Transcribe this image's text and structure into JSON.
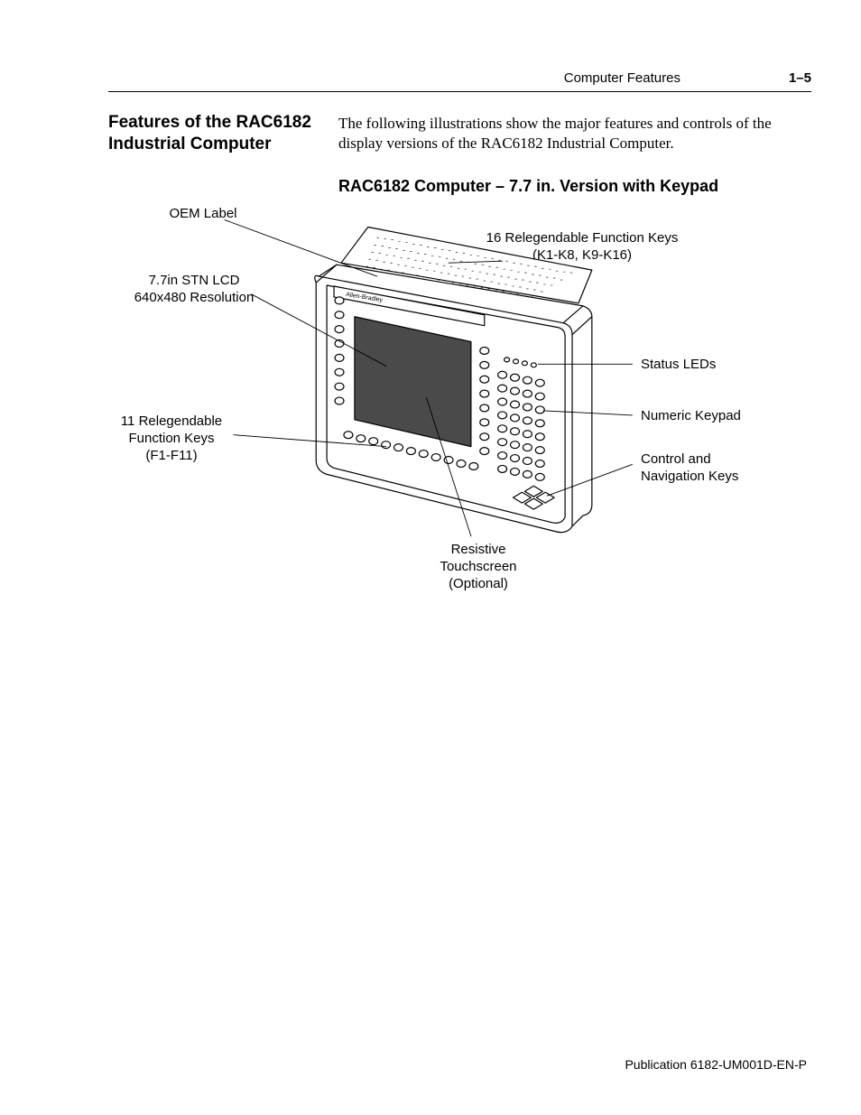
{
  "header": {
    "section": "Computer Features",
    "page": "1–5"
  },
  "section_heading": "Features of the RAC6182 Industrial Computer",
  "intro": "The following illustrations show the major features and controls of the display versions of the RAC6182 Industrial Computer.",
  "figure_title": "RAC6182 Computer – 7.7 in. Version with Keypad",
  "callouts": {
    "oem_label": "OEM Label",
    "lcd": "7.7in STN LCD\n640x480 Resolution",
    "f_keys": "11 Relegendable\nFunction Keys\n(F1-F11)",
    "k_keys": "16 Relegendable Function Keys\n(K1-K8, K9-K16)",
    "status_leds": "Status LEDs",
    "numeric_keypad": "Numeric Keypad",
    "nav_keys": "Control and\nNavigation Keys",
    "touchscreen": "Resistive\nTouchscreen\n(Optional)"
  },
  "footer": "Publication 6182-UM001D-EN-P"
}
